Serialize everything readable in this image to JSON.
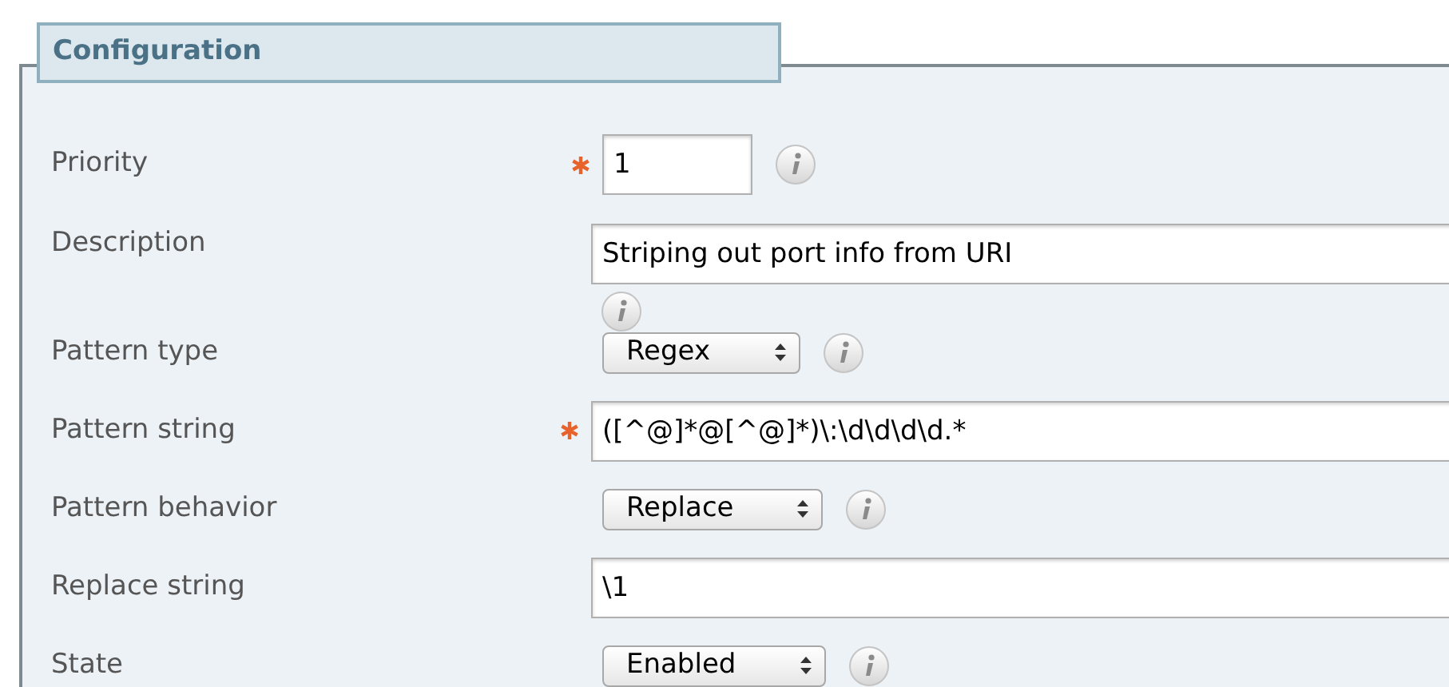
{
  "panel": {
    "title": "Configuration"
  },
  "fields": [
    {
      "label": "Priority",
      "kind": "short_text",
      "value": "1",
      "required": true,
      "info": true
    },
    {
      "label": "Description",
      "kind": "text",
      "value": "Striping out port info from URI",
      "required": false,
      "info": true
    },
    {
      "label": "Pattern type",
      "kind": "select",
      "value": "Regex",
      "required": false,
      "info": true
    },
    {
      "label": "Pattern string",
      "kind": "text",
      "value": "([^@]*@[^@]*)\\:\\d\\d\\d\\d.*",
      "required": true,
      "info": false
    },
    {
      "label": "Pattern behavior",
      "kind": "select",
      "value": "Replace",
      "required": false,
      "info": true
    },
    {
      "label": "Replace string",
      "kind": "text",
      "value": "\\1",
      "required": false,
      "info": false
    },
    {
      "label": "State",
      "kind": "select",
      "value": "Enabled",
      "required": false,
      "info": true
    }
  ]
}
